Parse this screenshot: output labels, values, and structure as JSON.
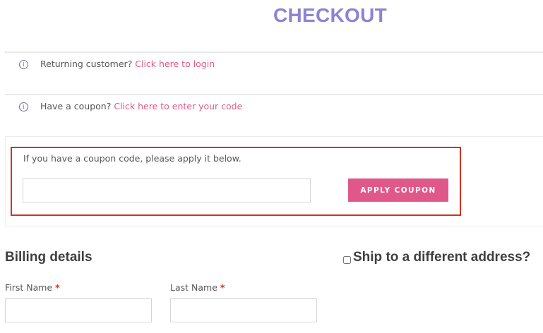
{
  "page": {
    "title": "CHECKOUT"
  },
  "notices": {
    "returning": {
      "icon": "info-circle-icon",
      "text": "Returning customer?",
      "link": "Click here to login"
    },
    "coupon": {
      "icon": "info-circle-icon",
      "text": "Have a coupon?",
      "link": "Click here to enter your code"
    }
  },
  "coupon_form": {
    "hint": "If you have a coupon code, please apply it below.",
    "input_value": "",
    "button_label": "APPLY COUPON"
  },
  "billing": {
    "title": "Billing details",
    "ship_to_different_label": "Ship to a different address?",
    "ship_to_different_checked": false,
    "first_name_label": "First Name",
    "last_name_label": "Last Name",
    "required_marker": "*",
    "first_name_value": "",
    "last_name_value": ""
  },
  "colors": {
    "title": "#8a85d1",
    "link": "#e0588a",
    "button": "#e0588a",
    "highlight": "#d4321f",
    "required": "#d4321f"
  }
}
